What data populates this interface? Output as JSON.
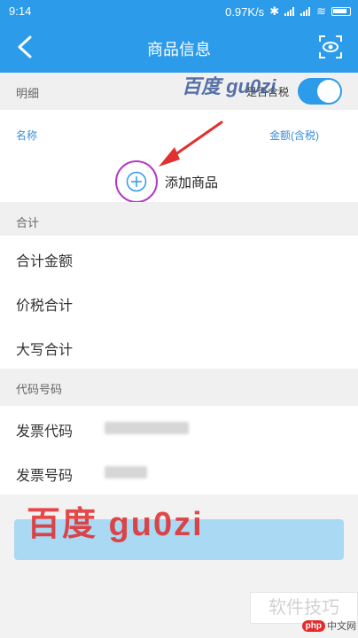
{
  "status": {
    "time": "9:14",
    "speed": "0.97K/s"
  },
  "nav": {
    "title": "商品信息"
  },
  "detail": {
    "section_label": "明细",
    "tax_toggle_label": "是否含税",
    "tax_included": true,
    "col_name": "名称",
    "col_amount": "金额(含税)",
    "add_label": "添加商品"
  },
  "totals": {
    "section_label": "合计",
    "rows": [
      "合计金额",
      "价税合计",
      "大写合计"
    ]
  },
  "codes": {
    "section_label": "代码号码",
    "rows": [
      "发票代码",
      "发票号码"
    ]
  },
  "watermarks": {
    "top": "百度 gu0zi",
    "bottom": "百度  gu0zi",
    "box": "软件技巧",
    "logo_badge": "php",
    "logo_site": "中文网"
  },
  "colors": {
    "primary": "#2b9bea",
    "highlight_ring": "#b23cc4",
    "arrow": "#e03030"
  }
}
